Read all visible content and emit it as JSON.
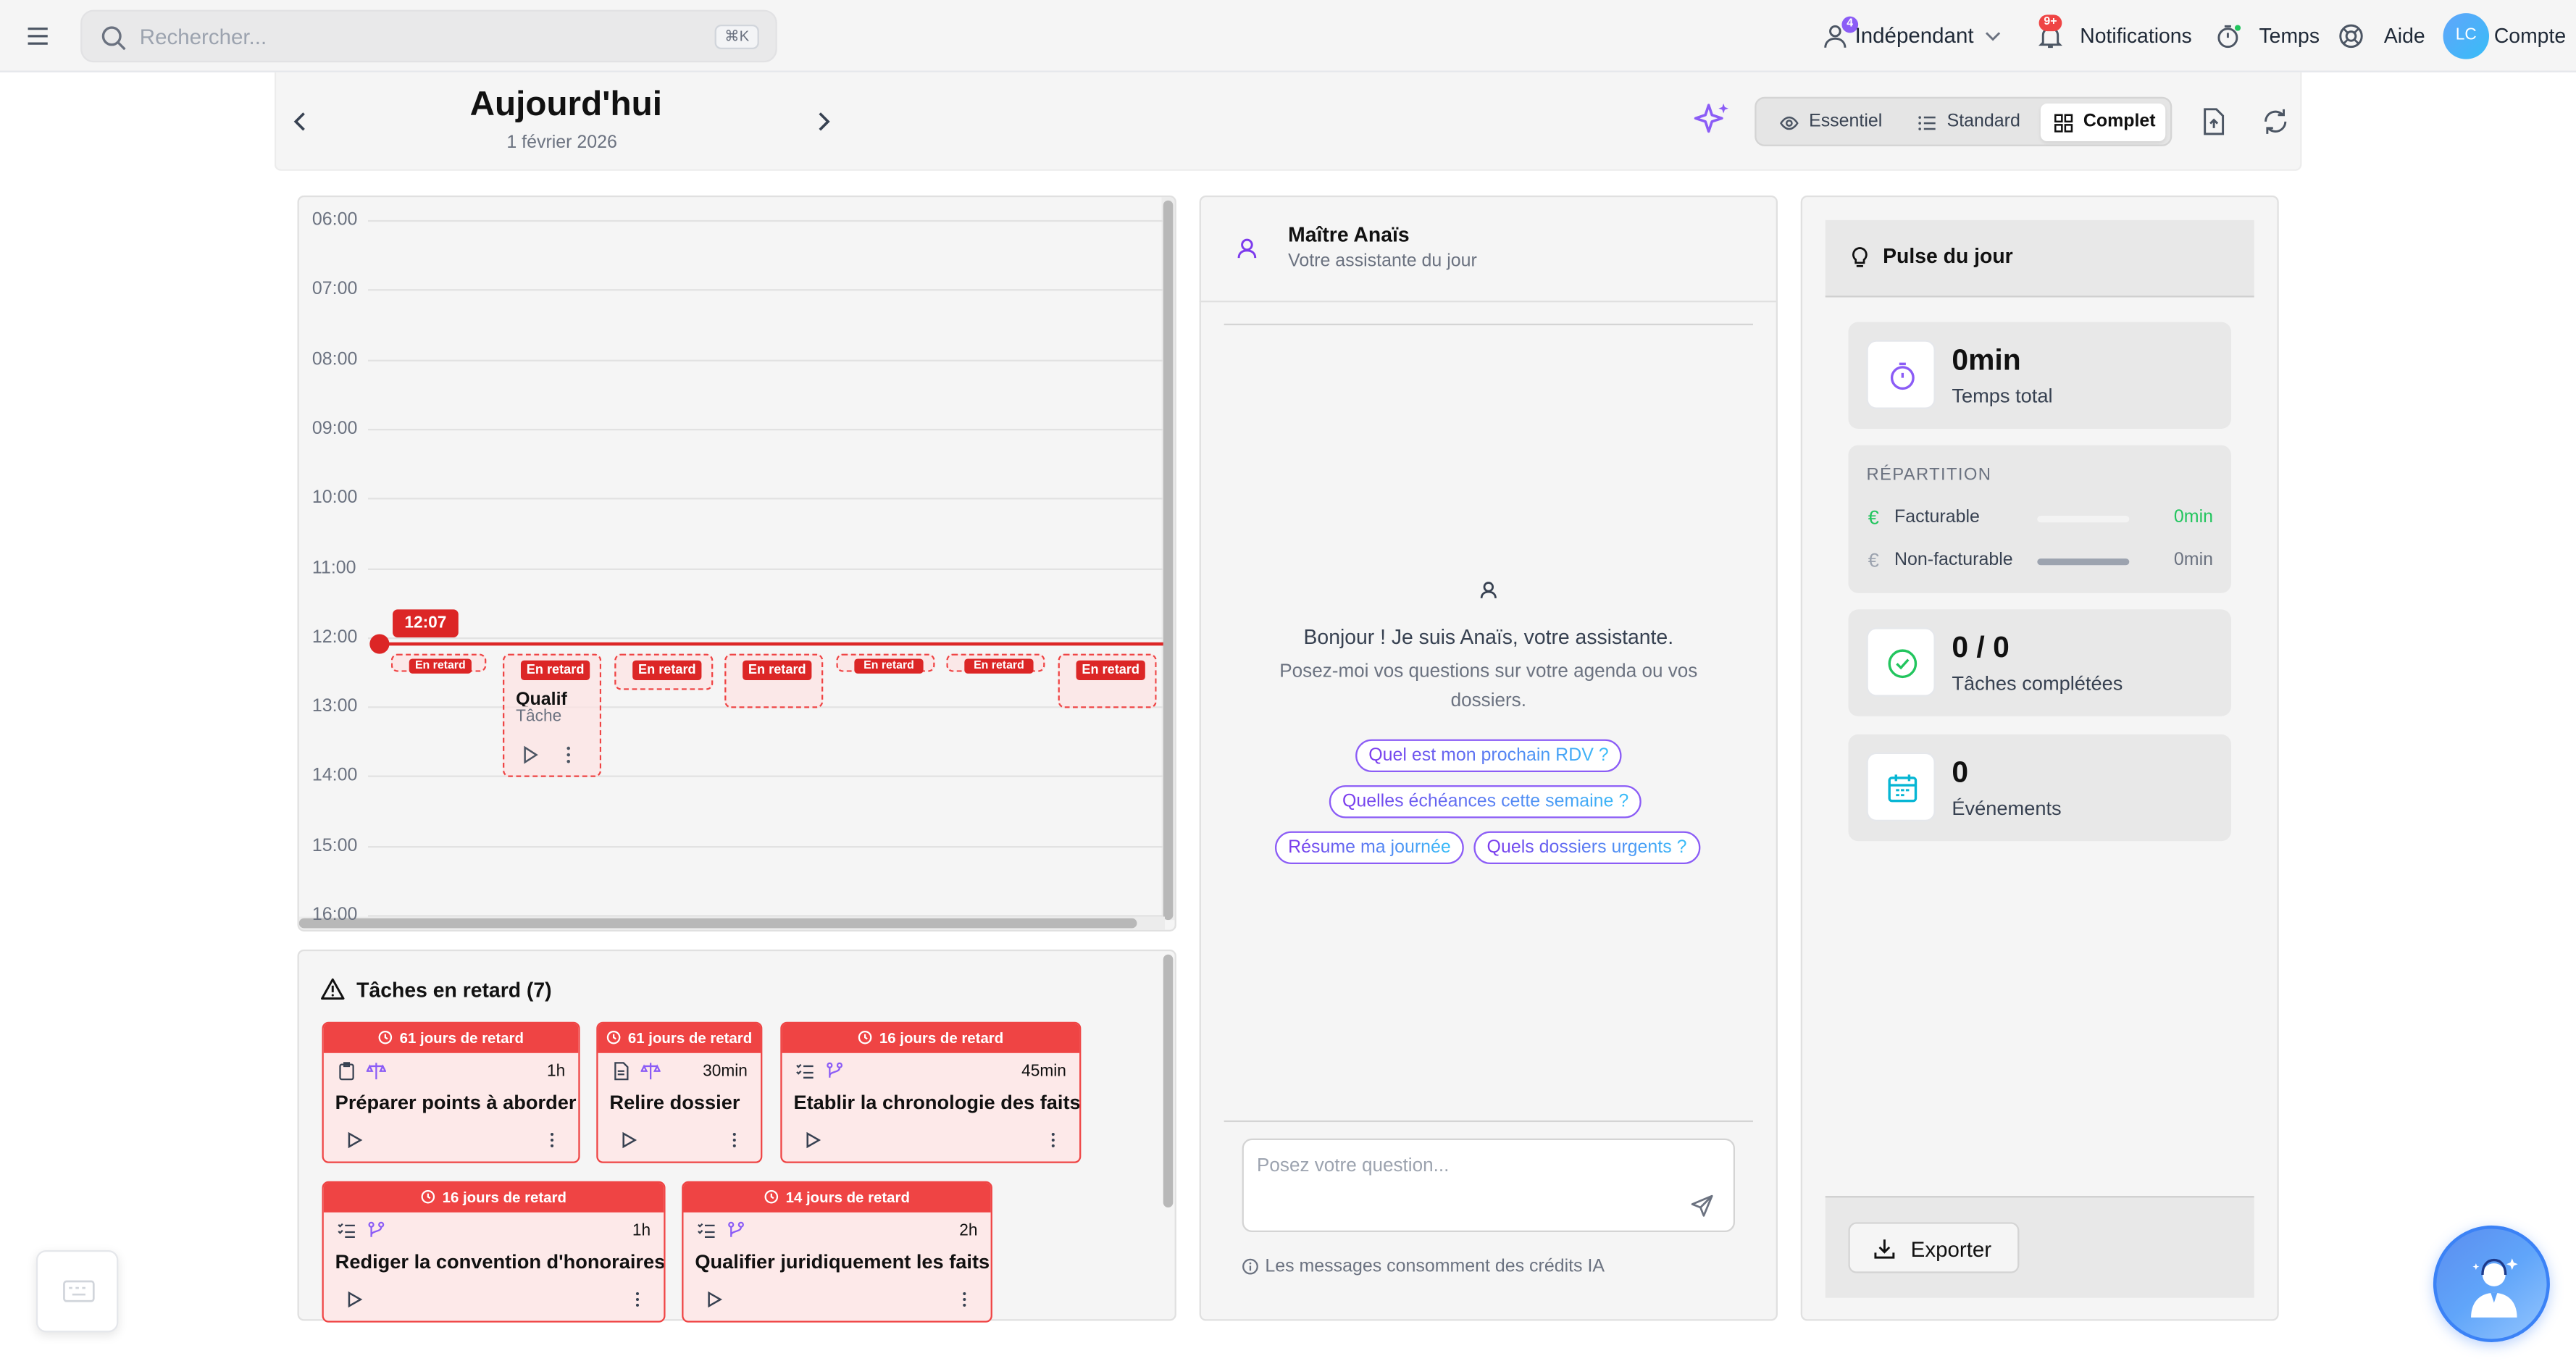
{
  "topbar": {
    "search_placeholder": "Rechercher...",
    "search_shortcut": "⌘K",
    "profile_label": "Indépendant",
    "profile_badge": "4",
    "notifications_label": "Notifications",
    "notifications_badge": "9+",
    "time_label": "Temps",
    "help_label": "Aide",
    "avatar_initials": "LC",
    "account_label": "Compte"
  },
  "header": {
    "title": "Aujourd'hui",
    "date": "1 février 2026",
    "views": [
      "Essentiel",
      "Standard",
      "Complet"
    ],
    "active_view": "Complet"
  },
  "agenda": {
    "hours": [
      "06:00",
      "07:00",
      "08:00",
      "09:00",
      "10:00",
      "11:00",
      "12:00",
      "13:00",
      "14:00",
      "15:00",
      "16:00"
    ],
    "now_time": "12:07",
    "events": [
      {
        "label": "En retard"
      },
      {
        "label": "En retard",
        "title": "Qualif",
        "type": "Tâche"
      },
      {
        "label": "En retard"
      },
      {
        "label": "En retard"
      },
      {
        "label": "En retard"
      },
      {
        "label": "En retard"
      },
      {
        "label": "En retard"
      }
    ]
  },
  "overdue": {
    "title": "Tâches en retard (7)",
    "tasks": [
      {
        "delay": "61 jours de retard",
        "title": "Préparer points à aborder",
        "duration": "1h"
      },
      {
        "delay": "61 jours de retard",
        "title": "Relire dossier",
        "duration": "30min"
      },
      {
        "delay": "16 jours de retard",
        "title": "Etablir la chronologie des faits",
        "duration": "45min"
      },
      {
        "delay": "16 jours de retard",
        "title": "Rediger la convention d'honoraires",
        "duration": "1h"
      },
      {
        "delay": "14 jours de retard",
        "title": "Qualifier juridiquement les faits",
        "duration": "2h"
      }
    ]
  },
  "assistant": {
    "name": "Maître Anaïs",
    "subtitle": "Votre assistante du jour",
    "greeting": "Bonjour ! Je suis Anaïs, votre assistante.",
    "intro": "Posez-moi vos questions sur votre agenda ou vos dossiers.",
    "suggestions": [
      "Quel est mon prochain RDV ?",
      "Quelles échéances cette semaine ?",
      "Résume ma journée",
      "Quels dossiers urgents ?"
    ],
    "input_placeholder": "Posez votre question...",
    "credits_note": "Les messages consomment des crédits IA"
  },
  "pulse": {
    "title": "Pulse du jour",
    "total_time_value": "0min",
    "total_time_label": "Temps total",
    "breakdown_title": "RÉPARTITION",
    "billable_label": "Facturable",
    "billable_value": "0min",
    "billable_fraction": 0,
    "non_billable_label": "Non-facturable",
    "non_billable_value": "0min",
    "non_billable_fraction": 1,
    "tasks_value": "0 / 0",
    "tasks_label": "Tâches complétées",
    "events_value": "0",
    "events_label": "Événements",
    "export_label": "Exporter"
  },
  "colors": {
    "danger": "#ef4444",
    "accent": "#8b5cf6",
    "billable": "#22c55e"
  }
}
